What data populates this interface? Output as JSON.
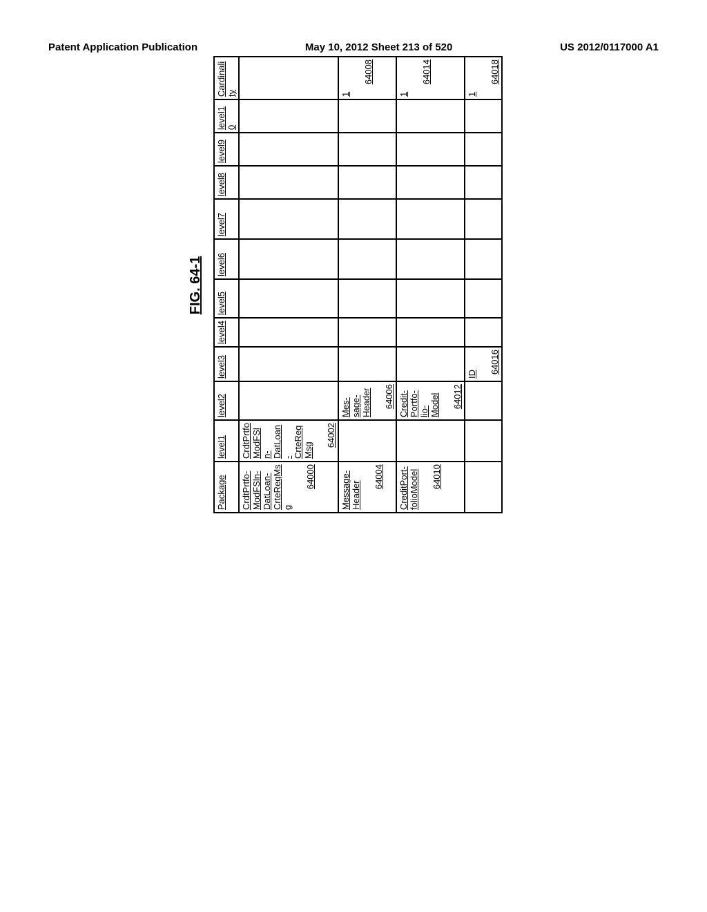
{
  "header": {
    "left": "Patent Application Publication",
    "center": "May 10, 2012  Sheet 213 of 520",
    "right": "US 2012/0117000 A1"
  },
  "figure": {
    "title": "FIG. 64-1"
  },
  "columns": [
    "Package",
    "level1",
    "level2",
    "level3",
    "level4",
    "level5",
    "level6",
    "level7",
    "level8",
    "level9",
    "level10",
    "Cardinality"
  ],
  "rows": [
    {
      "package": {
        "label": "CrdtPrtfo-ModFSln-DatLoan-CrteReqMsg",
        "ref": "64000"
      },
      "level1": {
        "label": "CrdtPrtfoModFSln-DatLoan-CrteReqMsg",
        "ref": "64002"
      },
      "level2": null,
      "level3": null,
      "cardinality": null
    },
    {
      "package": {
        "label": "Message-Header",
        "ref": "64004"
      },
      "level1": null,
      "level2": {
        "label": "Mes-sage-Header",
        "ref": "64006"
      },
      "level3": null,
      "cardinality": {
        "label": "1",
        "ref": "64008"
      }
    },
    {
      "package": {
        "label": "CreditPort-folioModel",
        "ref": "64010"
      },
      "level1": null,
      "level2": {
        "label": "Credit-Portfo-lio-Model",
        "ref": "64012"
      },
      "level3": null,
      "cardinality": {
        "label": "1",
        "ref": "64014"
      }
    },
    {
      "package": null,
      "level1": null,
      "level2": null,
      "level3": {
        "label": "ID",
        "ref": "64016"
      },
      "cardinality": {
        "label": "1",
        "ref": "64018"
      }
    }
  ]
}
